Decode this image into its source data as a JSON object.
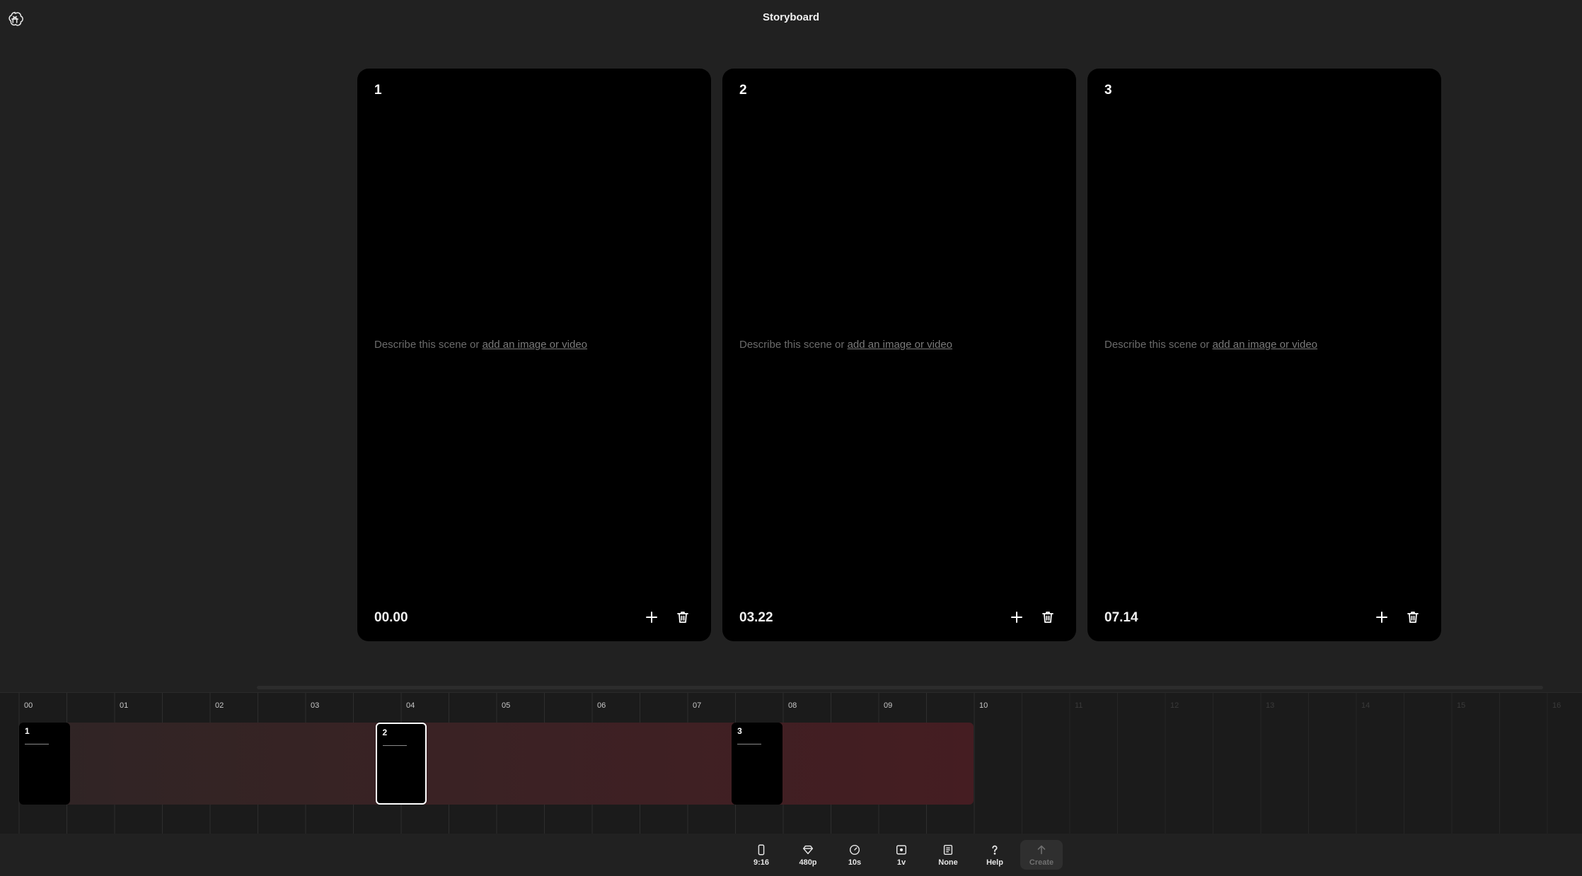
{
  "header": {
    "title": "Storyboard",
    "logo_icon": "openai-logo-icon"
  },
  "cards": [
    {
      "number": "1",
      "prompt_text": "Describe this scene or ",
      "prompt_link": "add an image or video",
      "time": "00.00"
    },
    {
      "number": "2",
      "prompt_text": "Describe this scene or ",
      "prompt_link": "add an image or video",
      "time": "03.22"
    },
    {
      "number": "3",
      "prompt_text": "Describe this scene or ",
      "prompt_link": "add an image or video",
      "time": "07.14"
    }
  ],
  "timeline": {
    "ticks": [
      "00",
      "01",
      "02",
      "03",
      "04",
      "05",
      "06",
      "07",
      "08",
      "09",
      "10",
      "11",
      "12",
      "13",
      "14",
      "15",
      "16"
    ],
    "active_until": 10,
    "clips": [
      {
        "number": "1",
        "start_seconds": 0,
        "selected": false
      },
      {
        "number": "2",
        "start_seconds": 3.73,
        "selected": true
      },
      {
        "number": "3",
        "start_seconds": 7.46,
        "selected": false
      }
    ]
  },
  "toolbar": {
    "aspect": "9:16",
    "resolution": "480p",
    "duration": "10s",
    "variations": "1v",
    "preset": "None",
    "help": "Help",
    "create": "Create"
  },
  "colors": {
    "background": "#212121",
    "card": "#000000",
    "track_start": "#2f2525",
    "track_end": "#451d22"
  }
}
